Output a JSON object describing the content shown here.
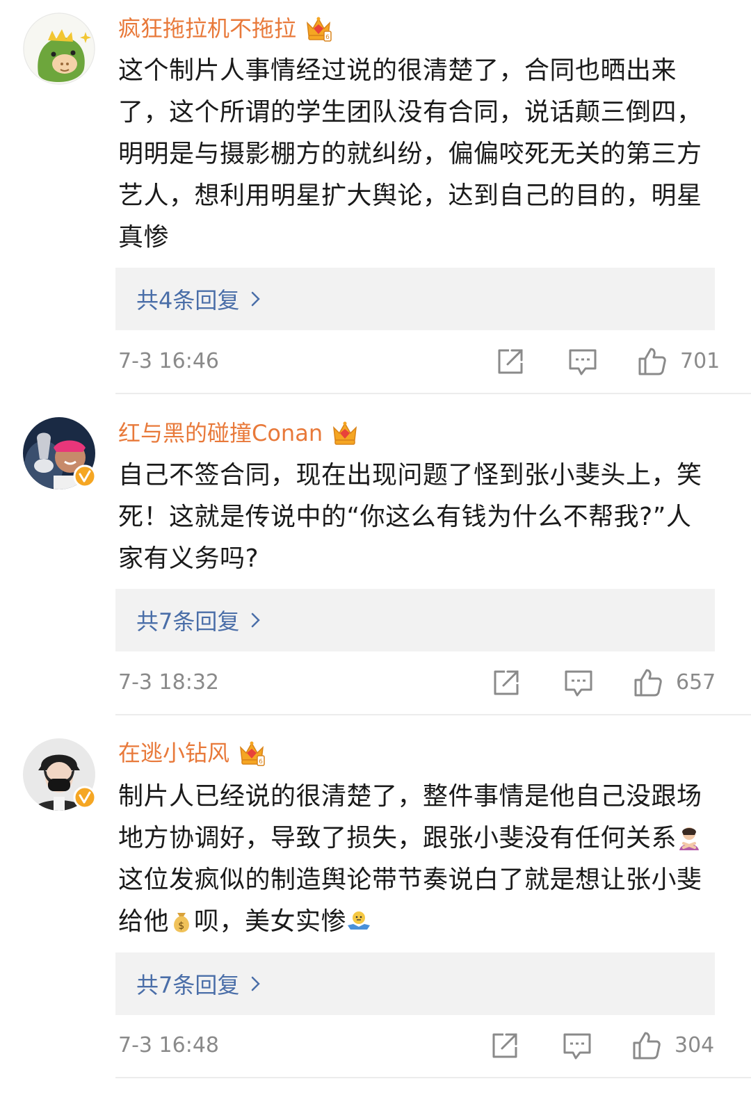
{
  "comments": [
    {
      "username": "疯狂拖拉机不拖拉",
      "avatar_icon": "dinosaur-avatar",
      "text": "这个制片人事情经过说的很清楚了，合同也晒出来了，这个所谓的学生团队没有合同，说话颠三倒四，明明是与摄影棚方的就纠纷，偏偏咬死无关的第三方艺人，想利用明星扩大舆论，达到自己的目的，明星真惨",
      "replies_label": "共4条回复",
      "timestamp": "7-3 16:46",
      "likes": "701"
    },
    {
      "username": "红与黑的碰撞Conan",
      "avatar_icon": "tennis-player-avatar",
      "text": "自己不签合同，现在出现问题了怪到张小斐头上，笑死！这就是传说中的“你这么有钱为什么不帮我?”人家有义务吗?",
      "replies_label": "共7条回复",
      "timestamp": "7-3 18:32",
      "likes": "657"
    },
    {
      "username": "在逃小钻风",
      "avatar_icon": "masked-girl-avatar",
      "text_part1": "制片人已经说的很清楚了，整件事情是他自己没跟场地方协调好，导致了损失，跟张小斐没有任何关系",
      "text_part2": "这位发疯似的制造舆论带节奏说白了就是想让张小斐给他",
      "text_part3": "呗，美女实惨",
      "replies_label": "共7条回复",
      "timestamp": "7-3 16:48",
      "likes": "304"
    }
  ],
  "colors": {
    "username": "#e8793a",
    "reply_link": "#4a6ea8",
    "meta": "#8a8a8a",
    "reply_bg": "#f2f2f2"
  },
  "icons": [
    "crown-badge-icon",
    "verified-badge-icon",
    "share-icon",
    "comment-icon",
    "like-icon",
    "chevron-right-icon",
    "facepalm-emoji",
    "money-bag-emoji",
    "shrug-emoji"
  ]
}
